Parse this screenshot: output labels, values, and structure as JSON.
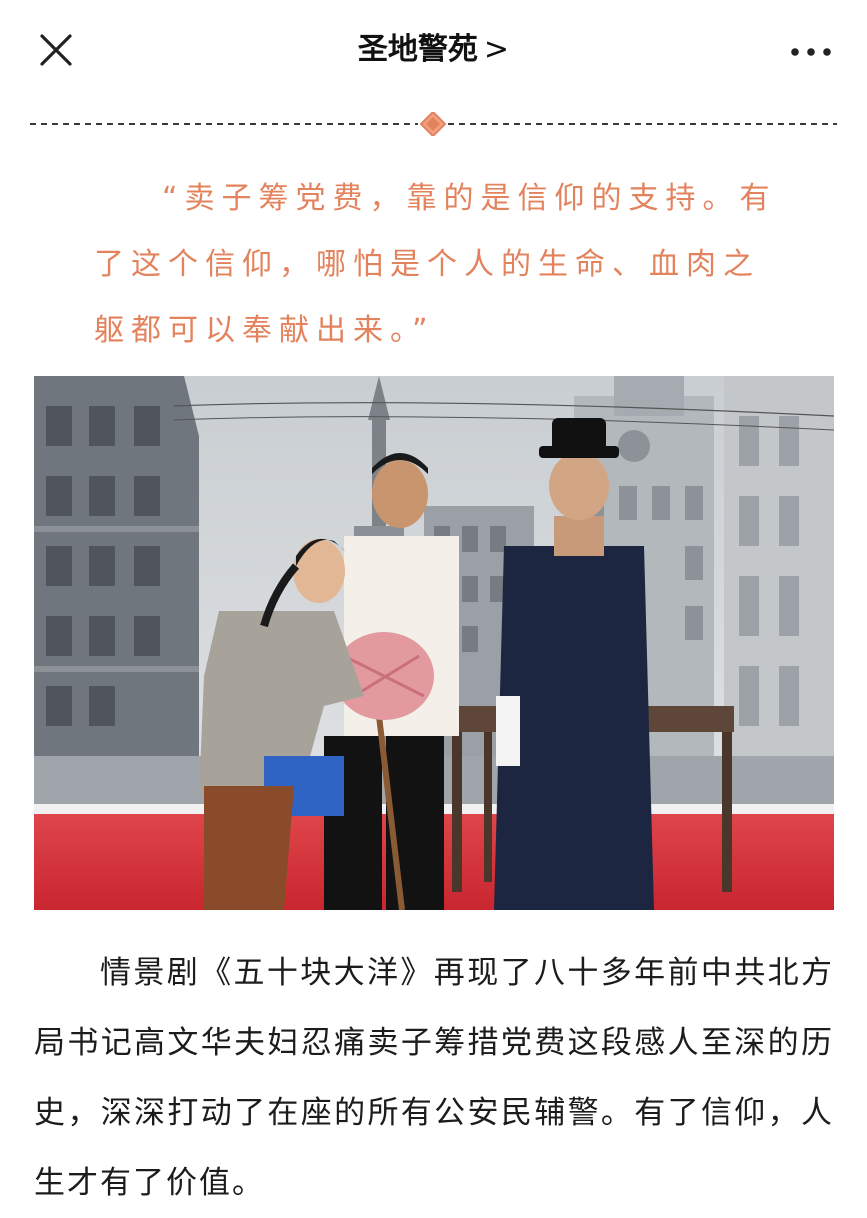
{
  "header": {
    "title": "圣地警苑",
    "title_chevron": ">",
    "close_icon": "close-icon",
    "more_icon": "more-horizontal-icon"
  },
  "article": {
    "quote": "“卖子筹党费，靠的是信仰的支持。有了这个信仰，哪怕是个人的生命、血肉之躯都可以奉献出来。”",
    "paragraph": "情景剧《五十块大洋》再现了八十多年前中共北方局书记高文华夫妇忍痛卖子筹措党费这段感人至深的历史，深深打动了在座的所有公安民辅警。有了信仰，人生才有了价值。"
  },
  "colors": {
    "quote_accent": "#e3835e",
    "divider_diamond": "#e3835e",
    "stage_carpet": "#d8343b"
  }
}
